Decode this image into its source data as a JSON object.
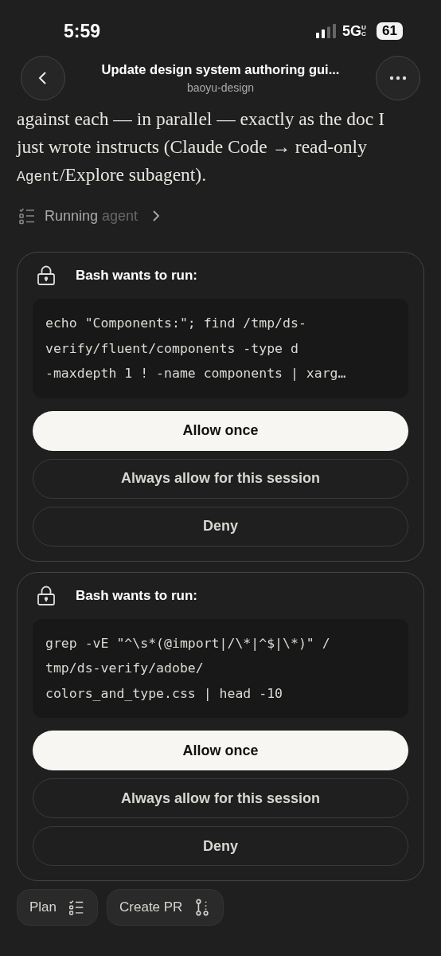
{
  "status_bar": {
    "time": "5:59",
    "network": "5G",
    "network_badge": "UC",
    "battery": "61"
  },
  "header": {
    "title": "Update design system authoring gui...",
    "subtitle": "baoyu-design"
  },
  "message": {
    "parts": [
      {
        "kind": "text",
        "text": "against each — in parallel — exactly as the doc I just wrote instructs (Claude Code → read-only "
      },
      {
        "kind": "code",
        "text": "Agent"
      },
      {
        "kind": "text",
        "text": "/Explore subagent)."
      }
    ]
  },
  "activity": {
    "label_bright": "Running",
    "label_dim": "agent"
  },
  "requests": [
    {
      "title": "Bash wants to run:",
      "command_lines": [
        "echo \"Components:\"; find /tmp/ds-",
        "verify/fluent/components -type d",
        "-maxdepth 1 ! -name components | xarg…"
      ],
      "buttons": [
        {
          "label": "Allow once",
          "kind": "primary"
        },
        {
          "label": "Always allow for this session",
          "kind": "outline"
        },
        {
          "label": "Deny",
          "kind": "outline"
        }
      ]
    },
    {
      "title": "Bash wants to run:",
      "command_lines": [
        "grep -vE \"^\\s*(@import|/\\*|^$|\\*)\" /",
        "tmp/ds-verify/adobe/",
        "colors_and_type.css | head -10"
      ],
      "buttons": [
        {
          "label": "Allow once",
          "kind": "primary"
        },
        {
          "label": "Always allow for this session",
          "kind": "outline"
        },
        {
          "label": "Deny",
          "kind": "outline"
        }
      ]
    }
  ],
  "footer_actions": [
    {
      "label": "Plan",
      "kind": "plan"
    },
    {
      "label": "Create PR",
      "kind": "pr"
    }
  ]
}
